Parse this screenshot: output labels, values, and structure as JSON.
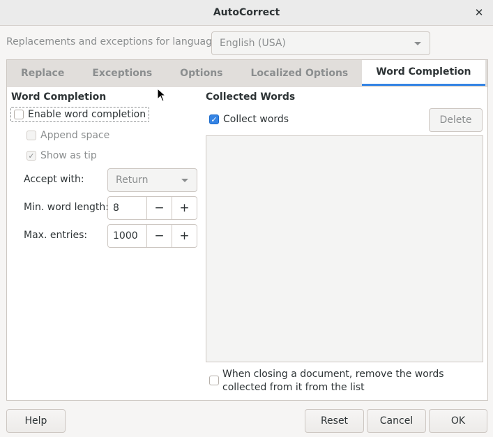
{
  "window": {
    "title": "AutoCorrect",
    "close_glyph": "✕"
  },
  "language": {
    "label": "Replacements and exceptions for language:",
    "value": "English (USA)"
  },
  "tabs": [
    {
      "label": "Replace"
    },
    {
      "label": "Exceptions"
    },
    {
      "label": "Options"
    },
    {
      "label": "Localized Options"
    },
    {
      "label": "Word Completion",
      "active": true
    }
  ],
  "left": {
    "title": "Word Completion",
    "enable_label": "Enable word completion",
    "enable_checked": false,
    "append_label": "Append space",
    "append_checked": false,
    "tip_label": "Show as tip",
    "tip_checked": true,
    "accept_label": "Accept with:",
    "accept_value": "Return",
    "min_label": "Min. word length:",
    "min_value": "8",
    "max_label": "Max. entries:",
    "max_value": "1000",
    "minus": "−",
    "plus": "+"
  },
  "right": {
    "title": "Collected Words",
    "collect_label": "Collect words",
    "collect_checked": true,
    "delete_label": "Delete",
    "remove_label": "When closing a document, remove the words collected from it from the list",
    "remove_checked": false
  },
  "footer": {
    "help": "Help",
    "reset": "Reset",
    "cancel": "Cancel",
    "ok": "OK"
  },
  "colors": {
    "accent": "#3584e4",
    "bg": "#f6f5f4"
  }
}
